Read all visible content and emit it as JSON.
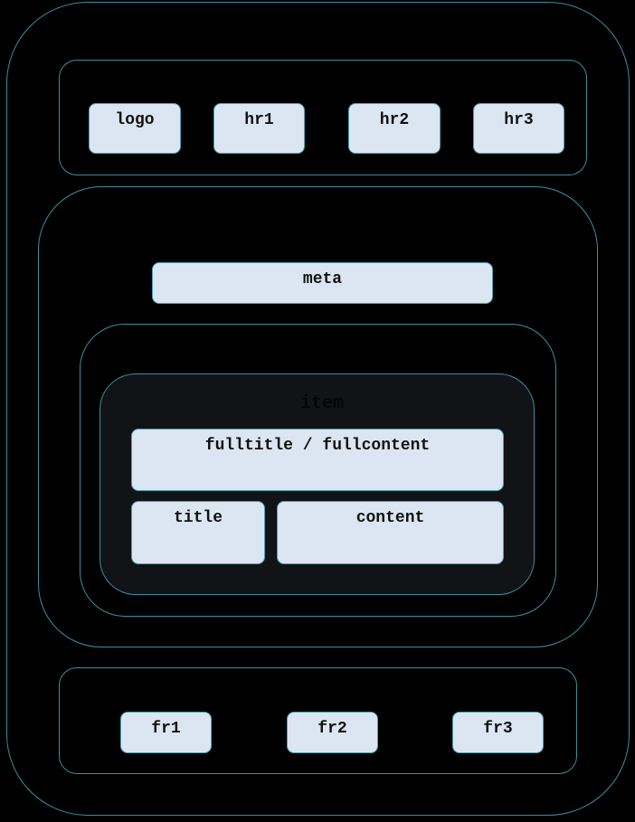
{
  "colors": {
    "stroke": "#3a8fa0",
    "box_fill": "#dce6f2",
    "item_fill": "#111316",
    "background": "#000000"
  },
  "header": {
    "items": [
      "logo",
      "hr1",
      "hr2",
      "hr3"
    ]
  },
  "main": {
    "meta": "meta",
    "item": {
      "label": "item",
      "fullrow": "fulltitle / fullcontent",
      "title": "title",
      "content": "content"
    }
  },
  "footer": {
    "items": [
      "fr1",
      "fr2",
      "fr3"
    ]
  }
}
